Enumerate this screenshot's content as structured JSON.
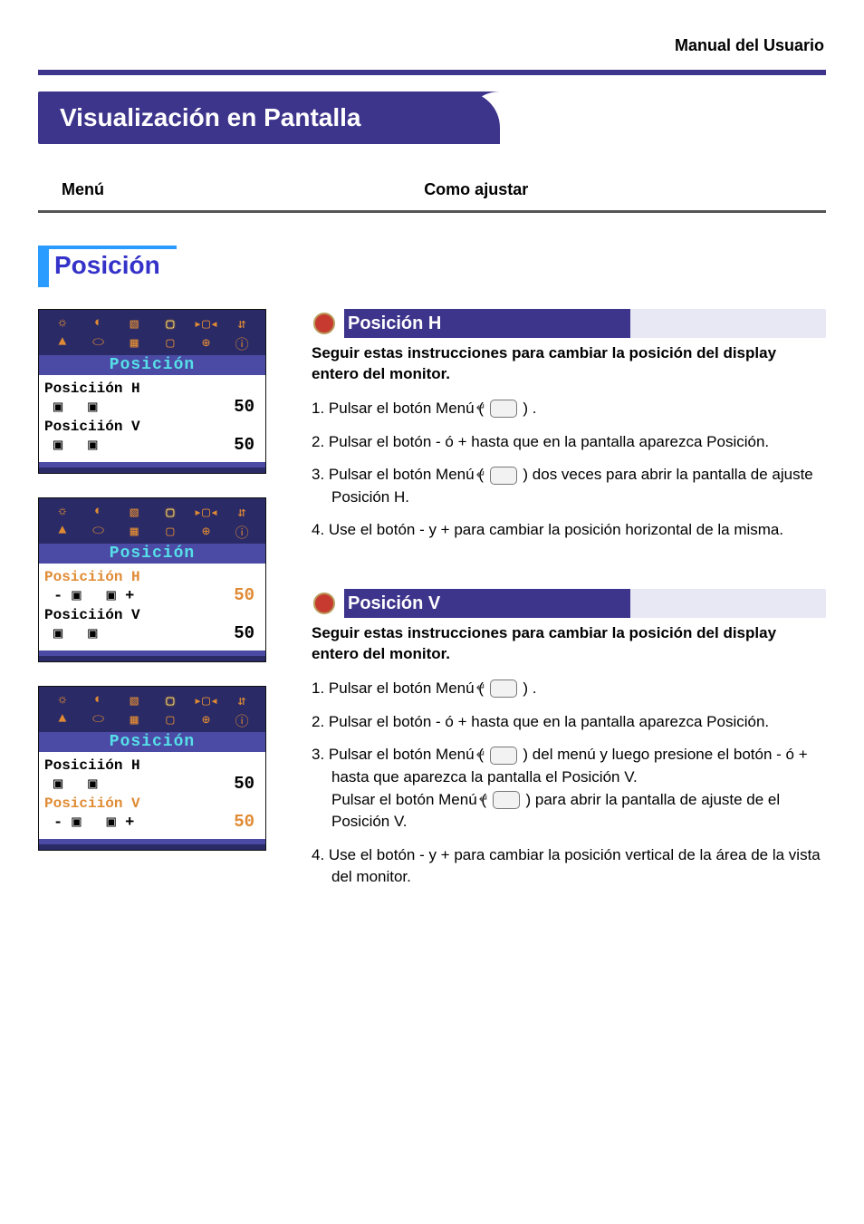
{
  "header": {
    "manual_title": "Manual del Usuario",
    "page_title": "Visualización en Pantalla",
    "menu_label": "Menú",
    "howto_label": "Como ajustar"
  },
  "position_heading": "Posición",
  "osd": {
    "title": "Posición",
    "h_label": "Posiciión H",
    "v_label": "Posiciión V",
    "value_h": "50",
    "value_v": "50",
    "icon_row1": [
      "☼",
      "◐",
      "▧",
      "▢",
      "▸▢◂",
      "⇵"
    ],
    "icon_row2": [
      "▲",
      "⬭",
      "▦",
      "▢",
      "⊕",
      "ⓘ"
    ]
  },
  "sections": {
    "h": {
      "title": "Posición H",
      "intro": "Seguir estas instrucciones para cambiar la posición del display entero del monitor.",
      "step1_a": "1. Pulsar el botón Menú ( ",
      "step1_b": " ) .",
      "step2": "2. Pulsar el botón - ó + hasta que en la pantalla aparezca Posición.",
      "step3_a": "3. Pulsar el botón Menú ( ",
      "step3_b": " ) dos veces para abrir la pantalla de ajuste Posición H.",
      "step4": "4. Use el botón - y + para cambiar la posición horizontal de la misma."
    },
    "v": {
      "title": "Posición V",
      "intro": "Seguir estas instrucciones para cambiar la posición del display entero del monitor.",
      "step1_a": "1. Pulsar el botón Menú ( ",
      "step1_b": " ) .",
      "step2": "2. Pulsar el botón - ó + hasta que en la pantalla aparezca Posición.",
      "step3_a": "3. Pulsar el botón Menú ( ",
      "step3_b": " ) del menú y luego presione el botón - ó + hasta que aparezca la pantalla el Posición V.",
      "step3c_a": "Pulsar el botón Menú ( ",
      "step3c_b": " ) para abrir la pantalla de ajuste de el Posición V.",
      "step4": "4. Use el botón - y + para cambiar la posición vertical de la área de la vista del monitor."
    }
  }
}
